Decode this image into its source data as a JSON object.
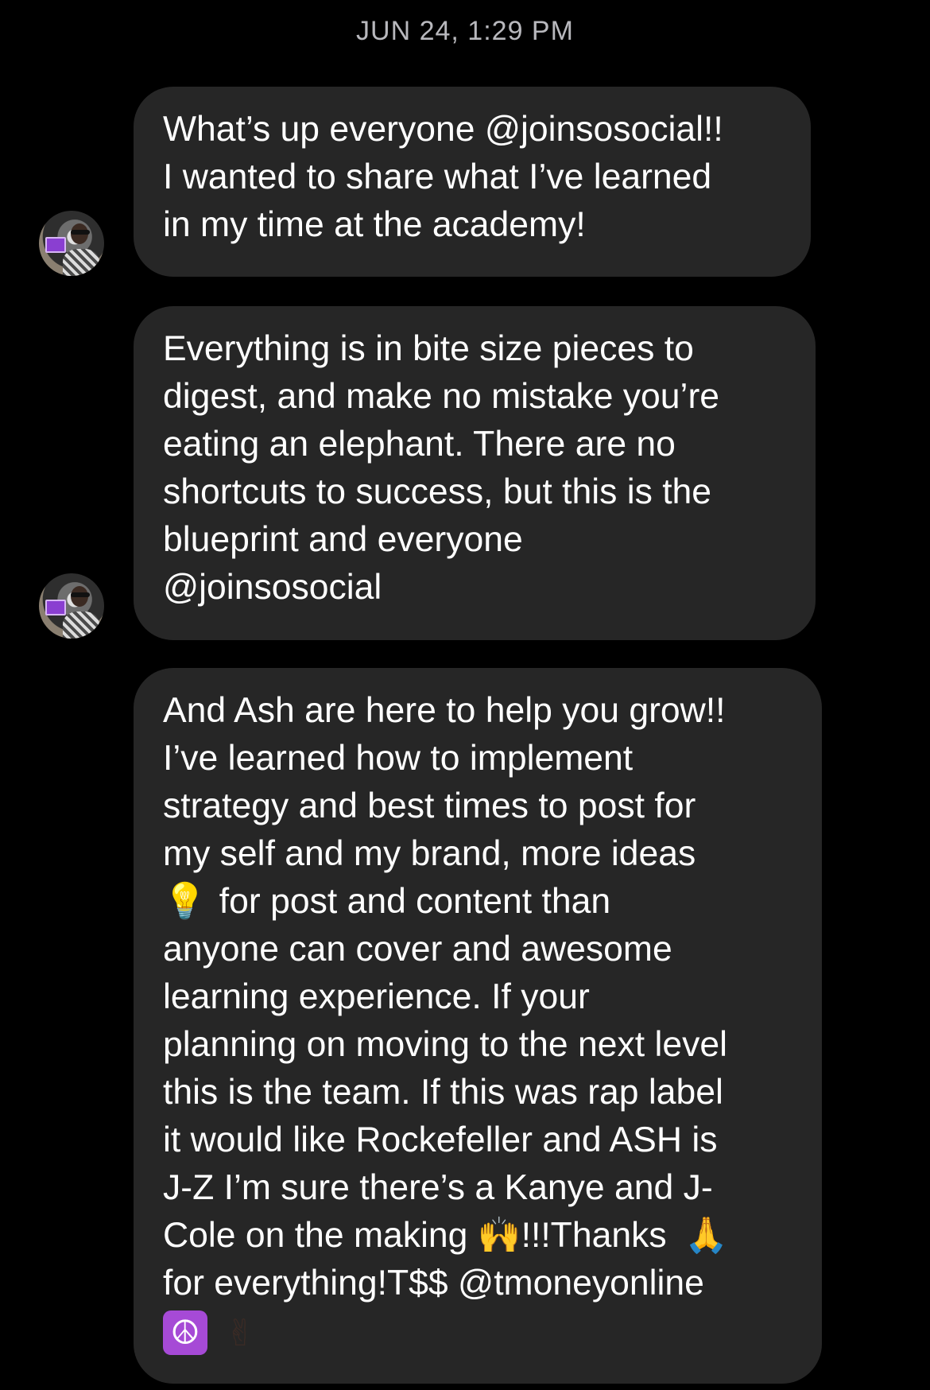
{
  "conversation": {
    "timestamp": "JUN 24, 1:29 PM",
    "messages": [
      {
        "text": "What’s up everyone @joinsosocial!!\nI wanted to share what I’ve learned\nin my time at the academy!"
      },
      {
        "text": "Everything is in bite size pieces to\ndigest, and make no mistake you’re\neating an elephant. There are no\nshortcuts to success, but this is the\nblueprint and everyone\n@joinsosocial"
      },
      {
        "text_part1": "And Ash are here to help you grow!!\nI’ve learned how to implement\nstrategy and best times to post for\nmy self and my brand, more ideas\n",
        "emoji_bulb": "💡",
        "text_part2": "for post and content than\nanyone can cover and awesome\nlearning experience. If your\nplanning on moving to the next level\nthis is the team. If this was rap label\nit would like Rockefeller and ASH is\nJ-Z I’m sure there’s a Kanye and J-\nCole on the making ",
        "emoji_raise": "🙌",
        "text_part3": "!!!Thanks ",
        "emoji_pray": "🙏",
        "text_part4": "\nfor everything!T$$ @tmoneyonline\n",
        "emoji_peace": "☮",
        "emoji_victory": "✌"
      }
    ]
  },
  "colors": {
    "background": "#000000",
    "bubble": "#262626",
    "timestamp": "#b8b8bd",
    "text": "#ffffff"
  },
  "icons": [
    "avatar-icon",
    "light-bulb-icon",
    "raising-hands-icon",
    "folded-hands-icon",
    "peace-symbol-icon",
    "victory-hand-icon"
  ]
}
